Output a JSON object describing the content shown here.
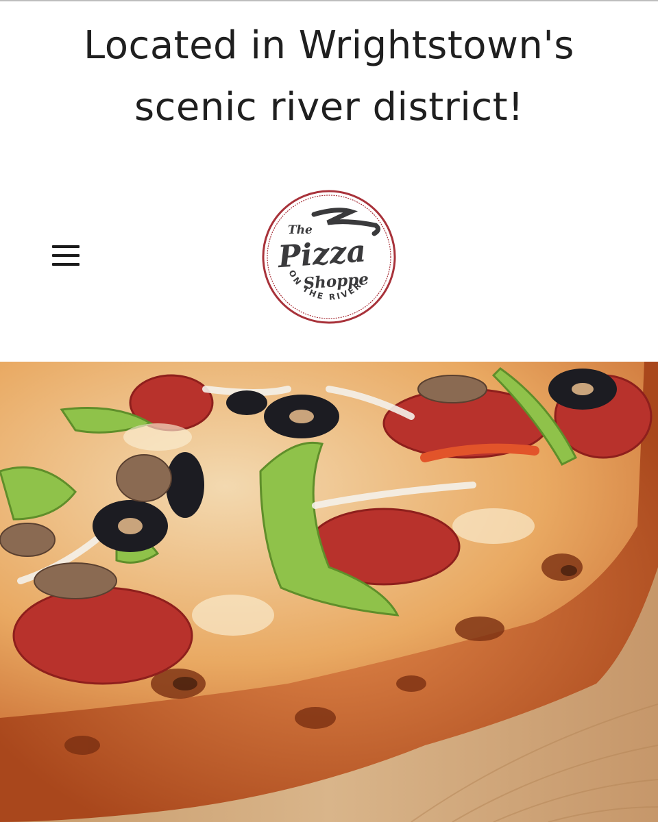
{
  "announcement": {
    "line1": "Located in Wrightstown's",
    "line2": "scenic river district!"
  },
  "header": {
    "menu_icon": "hamburger-menu-icon",
    "logo": {
      "line_the": "The",
      "line_pizza": "Pizza",
      "line_shoppe": "Shoppe",
      "line_river": "ON THE RIVER",
      "ring_color": "#a8323a",
      "ink_color": "#3a3a3c"
    }
  },
  "hero": {
    "subject": "pizza-photo"
  }
}
